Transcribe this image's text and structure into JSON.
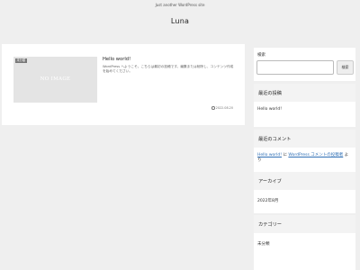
{
  "header": {
    "tagline": "Just another WordPress site",
    "site_title": "Luna"
  },
  "post": {
    "category": "未分類",
    "thumb_text": "NO IMAGE",
    "title": "Hello world!",
    "excerpt": "WordPress へようこそ。こちらは最初の投稿です。編集または削除し、コンテンツ作成を始めてください。",
    "date": "2022.08.20"
  },
  "sidebar": {
    "search": {
      "label": "検索",
      "placeholder": "",
      "button": "検索"
    },
    "recent_posts": {
      "title": "最近の投稿",
      "items": [
        "Hello world!"
      ]
    },
    "recent_comments": {
      "title": "最近のコメント",
      "author": "Hello world!",
      "connector": " に ",
      "post": "WordPress コメントの投稿者",
      "suffix": " より"
    },
    "archives": {
      "title": "アーカイブ",
      "items": [
        "2022年8月"
      ]
    },
    "categories": {
      "title": "カテゴリー",
      "items": [
        "未分類"
      ]
    }
  }
}
